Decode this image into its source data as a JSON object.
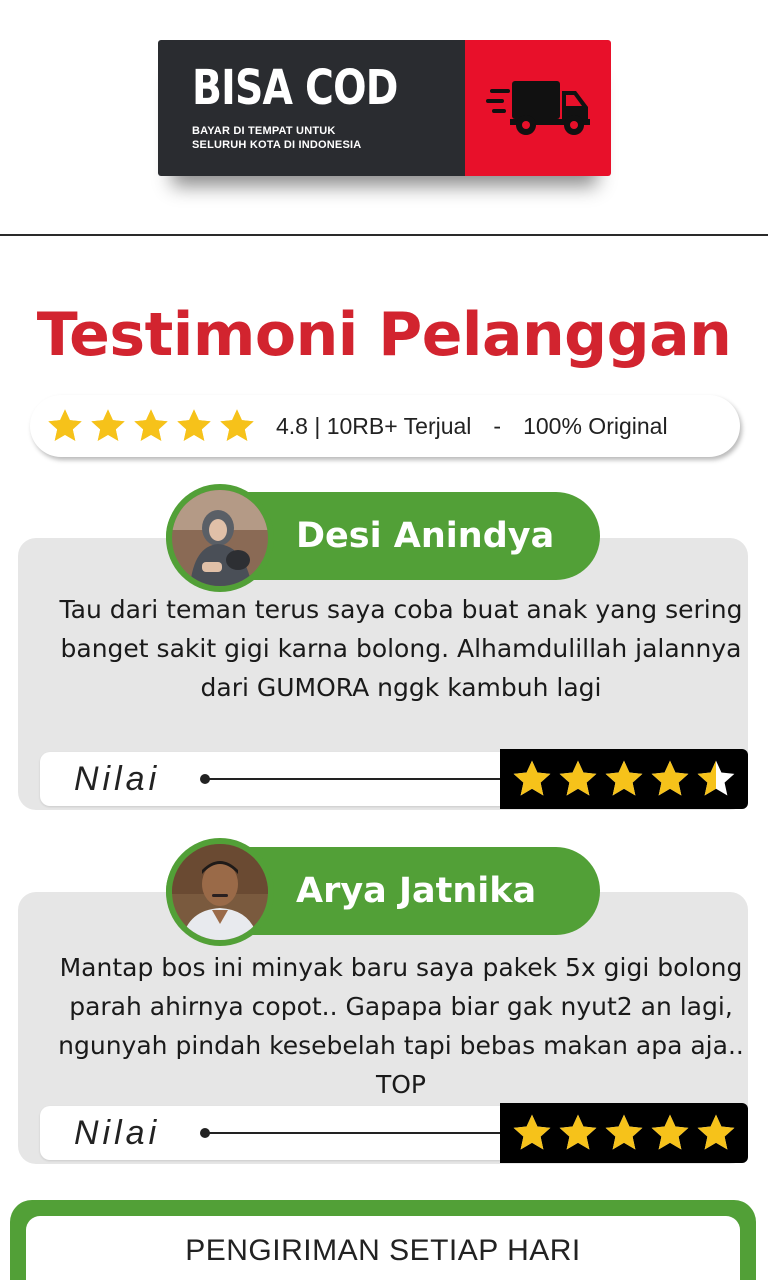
{
  "cod_banner": {
    "title": "BISA COD",
    "subtitle_line1": "BAYAR DI TEMPAT UNTUK",
    "subtitle_line2": "SELURUH KOTA DI INDONESIA",
    "icon": "delivery-truck-icon"
  },
  "heading": "Testimoni Pelanggan",
  "rating_pill": {
    "stars": 5,
    "summary": "4.8 | 10RB+ Terjual",
    "separator": "-",
    "original": "100% Original"
  },
  "testimonials": [
    {
      "name": "Desi Anindya",
      "review": "Tau dari teman terus saya coba buat anak yang sering banget sakit gigi karna bolong. Alhamdulillah jalannya dari GUMORA nggk kambuh lagi",
      "rating_label": "Nilai",
      "rating": 4.5
    },
    {
      "name": "Arya Jatnika",
      "review": "Mantap bos ini minyak baru saya pakek 5x gigi bolong parah ahirnya copot.. Gapapa biar gak nyut2 an lagi, ngunyah pindah kesebelah tapi bebas makan apa aja.. TOP",
      "rating_label": "Nilai",
      "rating": 5
    }
  ],
  "shipping": {
    "label": "PENGIRIMAN SETIAP HARI"
  },
  "colors": {
    "accent_red": "#d2242f",
    "cod_red": "#e8102a",
    "green": "#52a037",
    "star": "#f6c21a",
    "dark": "#2a2c30"
  }
}
